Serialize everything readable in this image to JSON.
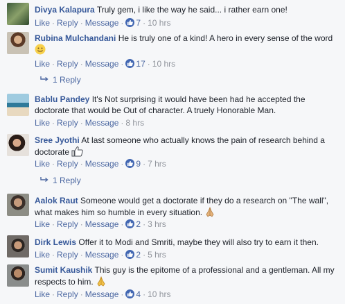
{
  "actions": {
    "like": "Like",
    "reply": "Reply",
    "message": "Message",
    "sep": "·"
  },
  "comments": [
    {
      "name": "Divya Kalapura",
      "text": "Truly gem, i like the way he said... i rather earn one!",
      "likes": "7",
      "time": "10 hrs"
    },
    {
      "name": "Rubina Mulchandani",
      "text": "He is truly one of a kind! A hero in every sense of the word",
      "emoji": "smile-emoji-icon",
      "likes": "17",
      "time": "10 hrs",
      "replies": "1 Reply"
    },
    {
      "name": "Bablu Pandey",
      "text": "It's Not surprising it would have been had he accepted the doctorate that would be Out of character. A truely Honorable Man.",
      "time": "8 hrs"
    },
    {
      "name": "Sree Jyothi",
      "text": "At last someone who actually knows the pain of research behind a doctorate",
      "emoji": "thumbs-up-emoji-icon",
      "likes": "9",
      "time": "7 hrs",
      "replies": "1 Reply"
    },
    {
      "name": "Aalok Raut",
      "text": "Someone would get a doctorate if they do a research on \"The wall\", what makes him so humble in every situation.",
      "emoji": "folded-hands-emoji-icon",
      "likes": "2",
      "time": "3 hrs"
    },
    {
      "name": "Dirk Lewis",
      "text": "Offer it to Modi and Smriti, maybe they will also try to earn it then.",
      "likes": "2",
      "time": "5 hrs"
    },
    {
      "name": "Sumit Kaushik",
      "text": "This guy is the epitome of a professional and a gentleman. All my respects to him.",
      "emoji": "folded-hands-emoji-icon",
      "likes": "4",
      "time": "10 hrs"
    }
  ]
}
